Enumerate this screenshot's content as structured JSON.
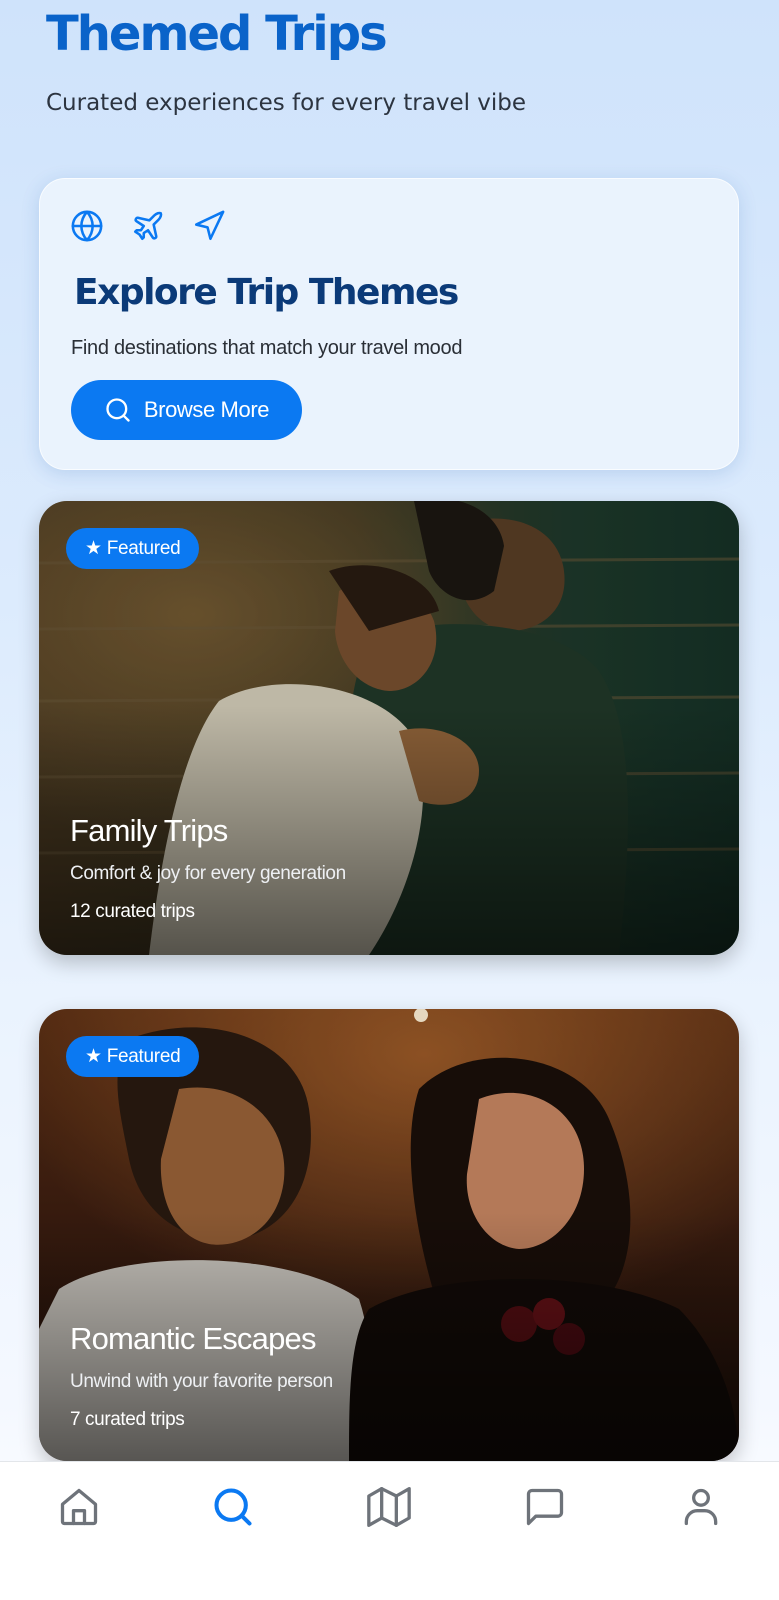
{
  "header": {
    "title": "Themed Trips",
    "subtitle": "Curated experiences for every travel vibe"
  },
  "explore": {
    "icons": [
      "globe-icon",
      "plane-icon",
      "navigation-icon"
    ],
    "title": "Explore Trip Themes",
    "subtitle": "Find destinations that match your travel mood",
    "button_label": "Browse More",
    "button_icon": "search-icon"
  },
  "trips": [
    {
      "badge": "★ Featured",
      "title": "Family Trips",
      "description": "Comfort & joy for every generation",
      "count": "12 curated trips"
    },
    {
      "badge": "★ Featured",
      "title": "Romantic Escapes",
      "description": "Unwind with your favorite person",
      "count": "7 curated trips"
    }
  ],
  "nav": {
    "items": [
      "home-icon",
      "search-icon",
      "map-icon",
      "chat-icon",
      "profile-icon"
    ],
    "active": "search-icon"
  },
  "colors": {
    "accent": "#0b79f2",
    "title_blue": "#0a63c9",
    "heading_navy": "#0b3a78",
    "nav_inactive": "#6e737a"
  }
}
